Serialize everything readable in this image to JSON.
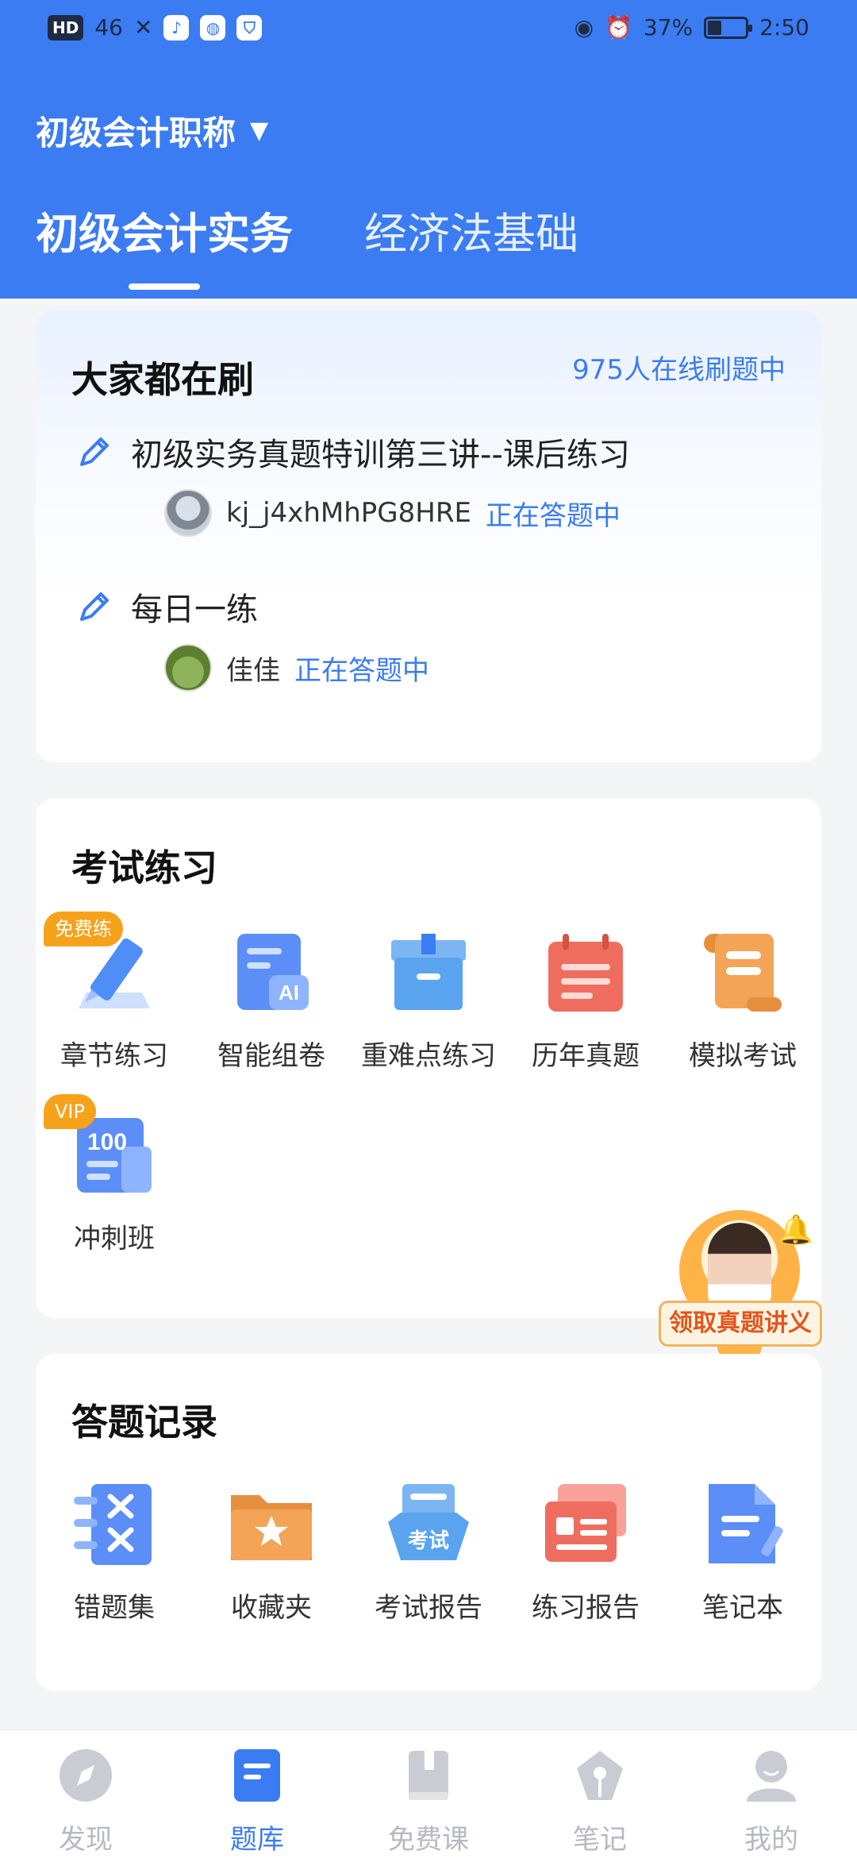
{
  "status_bar": {
    "left_chips": [
      "HD",
      "46",
      "✕",
      "♪",
      "◍",
      "⛉"
    ],
    "battery_percent": "37%",
    "battery_level": 0.37,
    "time": "2:50"
  },
  "header": {
    "certificate": "初级会计职称",
    "subject_tabs": [
      {
        "label": "初级会计实务",
        "active": true
      },
      {
        "label": "经济法基础",
        "active": false
      }
    ]
  },
  "hot_practice": {
    "title": "大家都在刷",
    "online_count": "975人在线刷题中",
    "items": [
      {
        "title": "初级实务真题特训第三讲--课后练习",
        "user": "kj_j4xhMhPG8HRE",
        "status": "正在答题中"
      },
      {
        "title": "每日一练",
        "user": "佳佳",
        "status": "正在答题中"
      }
    ]
  },
  "exam_practice": {
    "title": "考试练习",
    "items": [
      {
        "label": "章节练习",
        "icon": "pencil-icon",
        "tag": "免费练"
      },
      {
        "label": "智能组卷",
        "icon": "ai-paper-icon",
        "tag": ""
      },
      {
        "label": "重难点练习",
        "icon": "drawer-box-icon",
        "tag": ""
      },
      {
        "label": "历年真题",
        "icon": "calendar-doc-icon",
        "tag": ""
      },
      {
        "label": "模拟考试",
        "icon": "scroll-icon",
        "tag": ""
      },
      {
        "label": "冲刺班",
        "icon": "score-100-icon",
        "tag": "VIP"
      }
    ]
  },
  "promo": {
    "label": "领取真题讲义"
  },
  "answer_records": {
    "title": "答题记录",
    "items": [
      {
        "label": "错题集",
        "icon": "wrong-list-icon"
      },
      {
        "label": "收藏夹",
        "icon": "star-folder-icon"
      },
      {
        "label": "考试报告",
        "icon": "exam-report-icon",
        "badge": "考试"
      },
      {
        "label": "练习报告",
        "icon": "practice-report-icon"
      },
      {
        "label": "笔记本",
        "icon": "notebook-icon"
      }
    ]
  },
  "bottom_nav": [
    {
      "label": "发现",
      "icon": "compass-icon",
      "active": false
    },
    {
      "label": "题库",
      "icon": "question-bank-icon",
      "active": true
    },
    {
      "label": "免费课",
      "icon": "book-icon",
      "active": false
    },
    {
      "label": "笔记",
      "icon": "pen-nib-icon",
      "active": false
    },
    {
      "label": "我的",
      "icon": "profile-icon",
      "active": false
    }
  ],
  "colors": {
    "primary": "#3b7cf2",
    "tag_orange": "#f7a21b",
    "background": "#f4f5f7"
  }
}
